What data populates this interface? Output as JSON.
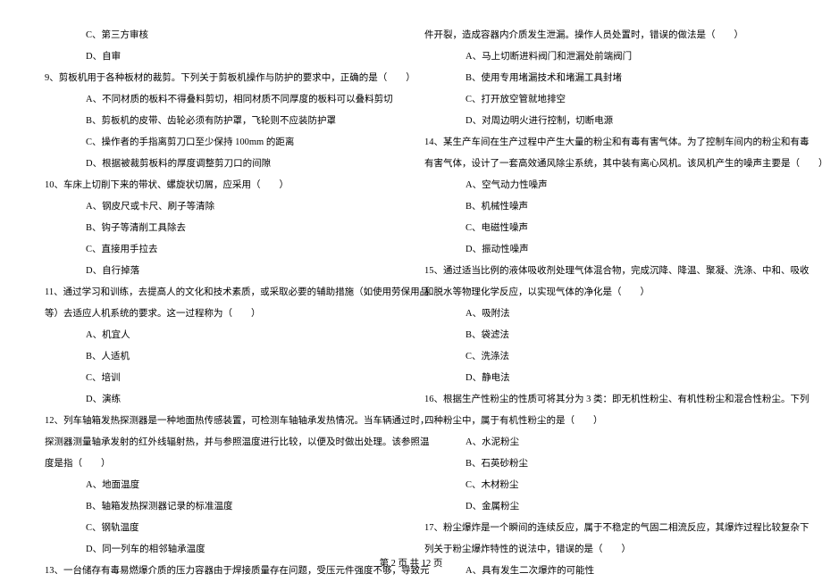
{
  "left": {
    "opt_c": "C、第三方审核",
    "opt_d": "D、自审",
    "q9": "9、剪板机用于各种板材的裁剪。下列关于剪板机操作与防护的要求中，正确的是（　　）",
    "q9a": "A、不同材质的板料不得叠料剪切，相同材质不同厚度的板料可以叠料剪切",
    "q9b": "B、剪板机的皮带、齿轮必须有防护罩，飞轮则不应装防护罩",
    "q9c": "C、操作者的手指离剪刀口至少保持 100mm 的距离",
    "q9d": "D、根据被裁剪板料的厚度调整剪刀口的间隙",
    "q10": "10、车床上切削下来的带状、螺旋状切屑，应采用（　　）",
    "q10a": "A、钢皮尺或卡尺、刷子等清除",
    "q10b": "B、钩子等清削工具除去",
    "q10c": "C、直接用手拉去",
    "q10d": "D、自行掉落",
    "q11": "11、通过学习和训练，去提高人的文化和技术素质，或采取必要的辅助措施（如使用劳保用品",
    "q11_cont": "等）去适应人机系统的要求。这一过程称为（　　）",
    "q11a": "A、机宜人",
    "q11b": "B、人适机",
    "q11c": "C、培训",
    "q11d": "D、演练",
    "q12": "12、列车轴箱发热探测器是一种地面热传感装置，可检测车轴轴承发热情况。当车辆通过时，",
    "q12_cont1": "探测器测量轴承发射的红外线辐射热，并与参照温度进行比较，以便及时做出处理。该参照温",
    "q12_cont2": "度是指（　　）",
    "q12a": "A、地面温度",
    "q12b": "B、轴箱发热探测器记录的标准温度",
    "q12c": "C、钢轨温度",
    "q12d": "D、同一列车的相邻轴承温度",
    "q13": "13、一台储存有毒易燃爆介质的压力容器由于焊接质量存在问题，受压元件强度不够，导致元"
  },
  "right": {
    "q13_cont": "件开裂，造成容器内介质发生泄漏。操作人员处置时，错误的做法是（　　）",
    "q13a": "A、马上切断进料阀门和泄漏处前端阀门",
    "q13b": "B、使用专用堵漏技术和堵漏工具封堵",
    "q13c": "C、打开放空管就地排空",
    "q13d": "D、对周边明火进行控制，切断电源",
    "q14": "14、某生产车间在生产过程中产生大量的粉尘和有毒有害气体。为了控制车间内的粉尘和有毒",
    "q14_cont": "有害气体，设计了一套高效通风除尘系统，其中装有离心风机。该风机产生的噪声主要是（　　）",
    "q14a": "A、空气动力性噪声",
    "q14b": "B、机械性噪声",
    "q14c": "C、电磁性噪声",
    "q14d": "D、振动性噪声",
    "q15": "15、通过适当比例的液体吸收剂处理气体混合物，完成沉降、降温、聚凝、洗涤、中和、吸收",
    "q15_cont": "和脱水等物理化学反应，以实现气体的净化是（　　）",
    "q15a": "A、吸附法",
    "q15b": "B、袋滤法",
    "q15c": "C、洗涤法",
    "q15d": "D、静电法",
    "q16": "16、根据生产性粉尘的性质可将其分为 3 类：即无机性粉尘、有机性粉尘和混合性粉尘。下列",
    "q16_cont": "四种粉尘中，属于有机性粉尘的是（　　）",
    "q16a": "A、水泥粉尘",
    "q16b": "B、石英砂粉尘",
    "q16c": "C、木材粉尘",
    "q16d": "D、金属粉尘",
    "q17": "17、粉尘爆炸是一个瞬间的连续反应，属于不稳定的气固二相流反应，其爆炸过程比较复杂下",
    "q17_cont": "列关于粉尘爆炸特性的说法中，错误的是（　　）",
    "q17a": "A、具有发生二次爆炸的可能性"
  },
  "footer": "第 2 页 共 12 页"
}
